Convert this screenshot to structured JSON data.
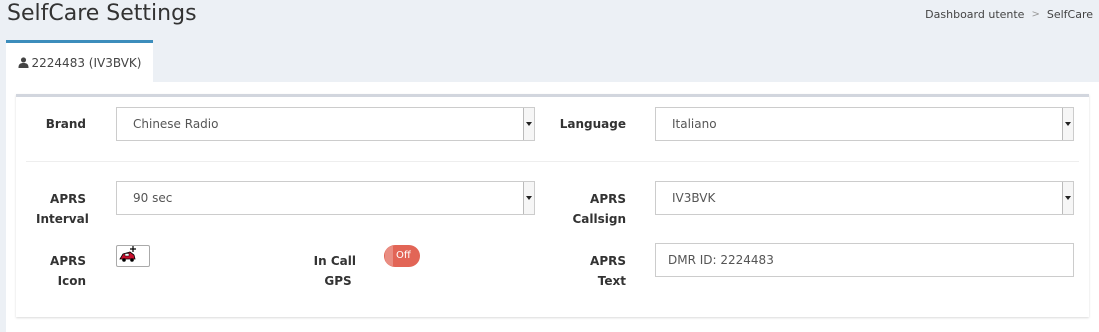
{
  "header": {
    "title": "SelfCare Settings",
    "breadcrumb": [
      "Dashboard utente",
      "SelfCare"
    ]
  },
  "tabs": [
    {
      "label": "2224483 (IV3BVK)",
      "icon": "user-icon"
    }
  ],
  "form": {
    "brand": {
      "label": "Brand",
      "value": "Chinese Radio"
    },
    "language": {
      "label": "Language",
      "value": "Italiano"
    },
    "aprs_interval": {
      "label_line1": "APRS",
      "label_line2": "Interval",
      "value": "90 sec"
    },
    "aprs_callsign": {
      "label_line1": "APRS",
      "label_line2": "Callsign",
      "value": "IV3BVK"
    },
    "aprs_icon": {
      "label_line1": "APRS",
      "label_line2": "Icon",
      "icon": "car-icon"
    },
    "in_call_gps": {
      "label_line1": "In Call",
      "label_line2": "GPS",
      "toggle_text": "Off",
      "state": false
    },
    "aprs_text": {
      "label_line1": "APRS",
      "label_line2": "Text",
      "value": "DMR ID: 2224483"
    }
  },
  "colors": {
    "accent": "#3c8dbc",
    "toggle_off": "#dd4b39",
    "background": "#ecf0f5"
  }
}
